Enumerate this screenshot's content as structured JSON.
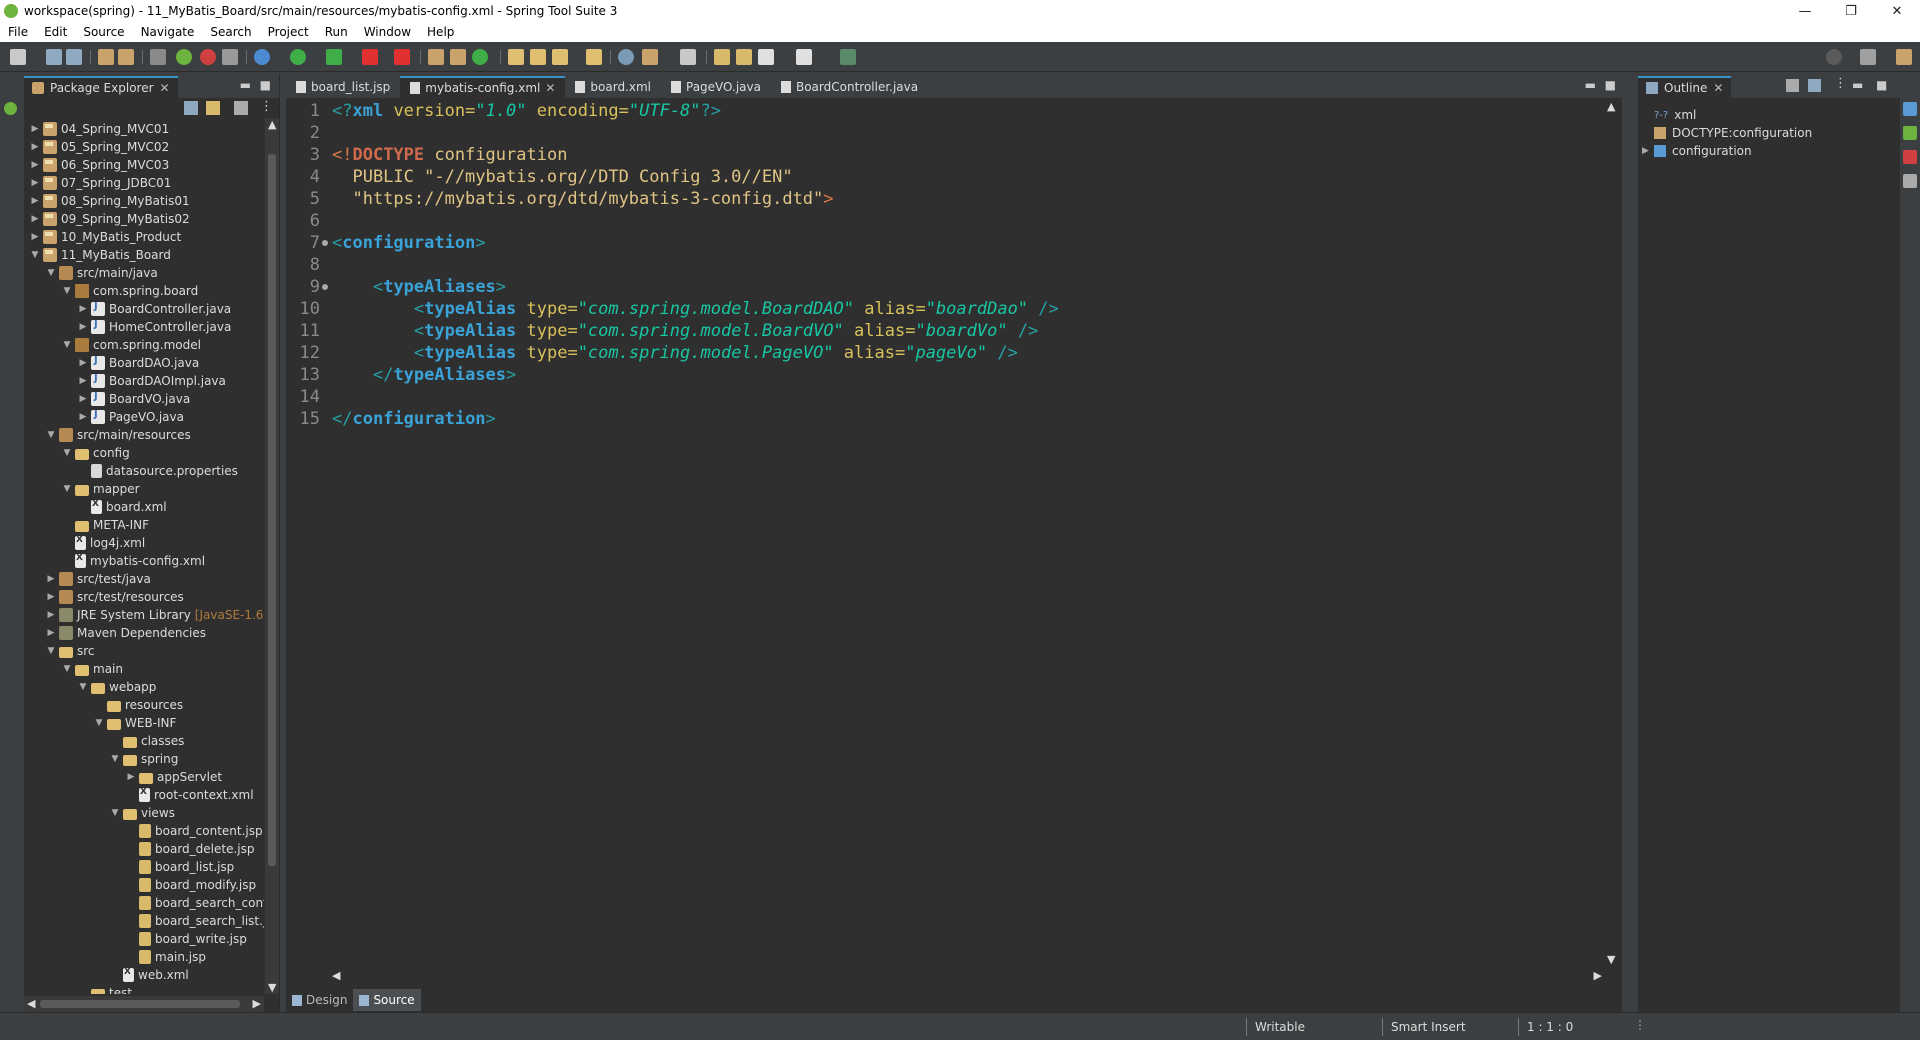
{
  "window": {
    "title": "workspace(spring) - 11_MyBatis_Board/src/main/resources/mybatis-config.xml - Spring Tool Suite 3",
    "minimize": "—",
    "restore": "❐",
    "close": "✕"
  },
  "menu": [
    "File",
    "Edit",
    "Source",
    "Navigate",
    "Search",
    "Project",
    "Run",
    "Window",
    "Help"
  ],
  "package_explorer": {
    "title": "Package Explorer",
    "items": [
      {
        "label": "04_Spring_MVC01",
        "icon": "project"
      },
      {
        "label": "05_Spring_MVC02",
        "icon": "project"
      },
      {
        "label": "06_Spring_MVC03",
        "icon": "project"
      },
      {
        "label": "07_Spring_JDBC01",
        "icon": "project"
      },
      {
        "label": "08_Spring_MyBatis01",
        "icon": "project"
      },
      {
        "label": "09_Spring_MyBatis02",
        "icon": "project"
      },
      {
        "label": "10_MyBatis_Product",
        "icon": "project"
      },
      {
        "label": "11_MyBatis_Board",
        "icon": "project"
      },
      {
        "label": "src/main/java",
        "icon": "srcfolder"
      },
      {
        "label": "com.spring.board",
        "icon": "package"
      },
      {
        "label": "BoardController.java",
        "icon": "java"
      },
      {
        "label": "HomeController.java",
        "icon": "java"
      },
      {
        "label": "com.spring.model",
        "icon": "package"
      },
      {
        "label": "BoardDAO.java",
        "icon": "java"
      },
      {
        "label": "BoardDAOImpl.java",
        "icon": "java"
      },
      {
        "label": "BoardVO.java",
        "icon": "java"
      },
      {
        "label": "PageVO.java",
        "icon": "java"
      },
      {
        "label": "src/main/resources",
        "icon": "srcfolder"
      },
      {
        "label": "config",
        "icon": "folder"
      },
      {
        "label": "datasource.properties",
        "icon": "file"
      },
      {
        "label": "mapper",
        "icon": "folder"
      },
      {
        "label": "board.xml",
        "icon": "xml"
      },
      {
        "label": "META-INF",
        "icon": "folder"
      },
      {
        "label": "log4j.xml",
        "icon": "xml"
      },
      {
        "label": "mybatis-config.xml",
        "icon": "xml"
      },
      {
        "label": "src/test/java",
        "icon": "srcfolder"
      },
      {
        "label": "src/test/resources",
        "icon": "srcfolder"
      },
      {
        "label": "JRE System Library",
        "icon": "lib",
        "decor": "[JavaSE-1.6]"
      },
      {
        "label": "Maven Dependencies",
        "icon": "lib"
      },
      {
        "label": "src",
        "icon": "folder"
      },
      {
        "label": "main",
        "icon": "folder"
      },
      {
        "label": "webapp",
        "icon": "folder"
      },
      {
        "label": "resources",
        "icon": "folder"
      },
      {
        "label": "WEB-INF",
        "icon": "folder"
      },
      {
        "label": "classes",
        "icon": "folder"
      },
      {
        "label": "spring",
        "icon": "folder"
      },
      {
        "label": "appServlet",
        "icon": "folder"
      },
      {
        "label": "root-context.xml",
        "icon": "xml"
      },
      {
        "label": "views",
        "icon": "folder"
      },
      {
        "label": "board_content.jsp",
        "icon": "jsp"
      },
      {
        "label": "board_delete.jsp",
        "icon": "jsp"
      },
      {
        "label": "board_list.jsp",
        "icon": "jsp"
      },
      {
        "label": "board_modify.jsp",
        "icon": "jsp"
      },
      {
        "label": "board_search_cont...",
        "icon": "jsp"
      },
      {
        "label": "board_search_list.js",
        "icon": "jsp"
      },
      {
        "label": "board_write.jsp",
        "icon": "jsp"
      },
      {
        "label": "main.jsp",
        "icon": "jsp"
      },
      {
        "label": "web.xml",
        "icon": "xml"
      },
      {
        "label": "test",
        "icon": "folder"
      }
    ]
  },
  "editor": {
    "tabs": [
      "board_list.jsp",
      "mybatis-config.xml",
      "board.xml",
      "PageVO.java",
      "BoardController.java"
    ],
    "active_tab": "mybatis-config.xml",
    "line_numbers": [
      "1",
      "2",
      "3",
      "4",
      "5",
      "6",
      "7",
      "8",
      "9",
      "10",
      "11",
      "12",
      "13",
      "14",
      "15"
    ],
    "code": {
      "l1": {
        "open": "<?",
        "name": "xml",
        "a1": " version=",
        "v1": "\"1.0\"",
        "a2": " encoding=",
        "v2": "\"UTF-8\"",
        "close": "?>"
      },
      "l3": {
        "open": "<!",
        "kw": "DOCTYPE",
        "rest": " configuration"
      },
      "l4": "  PUBLIC \"-//mybatis.org//DTD Config 3.0//EN\"",
      "l5": {
        "str": "  \"https://mybatis.org/dtd/mybatis-3-config.dtd\"",
        "close": ">"
      },
      "l7": {
        "open": "<",
        "tag": "configuration",
        "close": ">"
      },
      "l9": {
        "indent": "    ",
        "open": "<",
        "tag": "typeAliases",
        "close": ">"
      },
      "l10": {
        "indent": "        ",
        "open": "<",
        "tag": "typeAlias",
        "a1": " type=",
        "v1": "\"com.spring.model.BoardDAO\"",
        "a2": " alias=",
        "v2": "\"boardDao\"",
        "close": " />"
      },
      "l11": {
        "indent": "        ",
        "open": "<",
        "tag": "typeAlias",
        "a1": " type=",
        "v1": "\"com.spring.model.BoardVO\"",
        "a2": " alias=",
        "v2": "\"boardVo\"",
        "close": " />"
      },
      "l12": {
        "indent": "        ",
        "open": "<",
        "tag": "typeAlias",
        "a1": " type=",
        "v1": "\"com.spring.model.PageVO\"",
        "a2": " alias=",
        "v2": "\"pageVo\"",
        "close": " />"
      },
      "l13": {
        "indent": "    ",
        "open": "</",
        "tag": "typeAliases",
        "close": ">"
      },
      "l15": {
        "open": "</",
        "tag": "configuration",
        "close": ">"
      }
    },
    "bottom_tabs": [
      "Design",
      "Source"
    ],
    "active_bottom_tab": "Source"
  },
  "outline": {
    "title": "Outline",
    "items": [
      {
        "label": "xml",
        "prefix": "?-?"
      },
      {
        "label": "DOCTYPE:configuration"
      },
      {
        "label": "configuration"
      }
    ]
  },
  "status": {
    "writable": "Writable",
    "insert_mode": "Smart Insert",
    "position": "1 : 1 : 0"
  }
}
